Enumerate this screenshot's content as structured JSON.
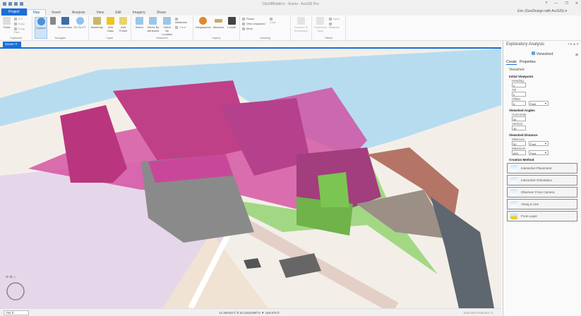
{
  "window": {
    "title": "CityOfMobile's - Scene - ArcGIS Pro",
    "help": "?",
    "minimize": "—",
    "restore": "❐",
    "close": "✕"
  },
  "user": "Eric (GeoDesign with ArcGIS) ▾",
  "tabs": [
    "Project",
    "Map",
    "Insert",
    "Analysis",
    "View",
    "Edit",
    "Imagery",
    "Share"
  ],
  "ribbon": {
    "clipboard": {
      "label": "Clipboard",
      "paste": "Paste",
      "cut": "Cut",
      "copy": "Copy",
      "copy_path": "Copy Path"
    },
    "navigate": {
      "label": "Navigate",
      "explore": "Explore",
      "bookmarks": "Bookmarks",
      "goto": "Go To XY"
    },
    "layer": {
      "label": "Layer",
      "basemap": "Basemap",
      "add_data": "Add Data",
      "add_preset": "Add Preset"
    },
    "selection": {
      "label": "Selection",
      "select": "Select",
      "by_attr": "Select By Attributes",
      "by_loc": "Select By Location",
      "attributes": "Attributes",
      "clear": "Clear"
    },
    "inquiry": {
      "label": "Inquiry",
      "infographics": "Infographics",
      "measure": "Measure",
      "locate": "Locate"
    },
    "labeling": {
      "label": "Labeling",
      "pause": "Pause",
      "lock": "Lock",
      "view_unplaced": "View Unplaced",
      "more": "More",
      "convert": "Convert To Annotation"
    },
    "offline": {
      "label": "Offline",
      "download": "Download Map",
      "sync": "Sync",
      "remove": "Remove"
    }
  },
  "view_tab": "Scene",
  "status": {
    "scale": "784 ft",
    "coords": "13.3934371°E 52.5252398°N ▼ 156.876 ft",
    "selected": "Selected Features: 0"
  },
  "panel": {
    "title": "Exploratory Analysis",
    "controls": "? ▾ ⇲ ✕",
    "tool": "Viewshed",
    "tabs": [
      "Create",
      "Properties"
    ],
    "section": "Viewshed",
    "initial": {
      "heading": "Initial Viewpoint",
      "heading_lbl": "Heading",
      "heading_val": "0",
      "tilt_lbl": "Tilt",
      "tilt_val": "0",
      "offset_lbl": "Offset",
      "offset_val": "6",
      "offset_unit": "Feet"
    },
    "angles": {
      "heading": "Viewshed Angles",
      "h_lbl": "Horizontal",
      "h_val": "60",
      "v_lbl": "Vertical",
      "v_val": "45"
    },
    "distance": {
      "heading": "Viewshed Distance",
      "min_lbl": "Minimum",
      "min_val": "50",
      "min_unit": "Feet",
      "max_lbl": "Maximum",
      "max_val": "600",
      "max_unit": "Feet"
    },
    "methods_heading": "Creation Method",
    "methods": [
      "Interactive Placement",
      "Interactive Orientation",
      "Observer From Camera",
      "Along a Line",
      "From Layer"
    ]
  },
  "colors": {
    "accent": "#1a6ed8",
    "visible": "#7fcf5a",
    "hidden": "#d2419a"
  }
}
